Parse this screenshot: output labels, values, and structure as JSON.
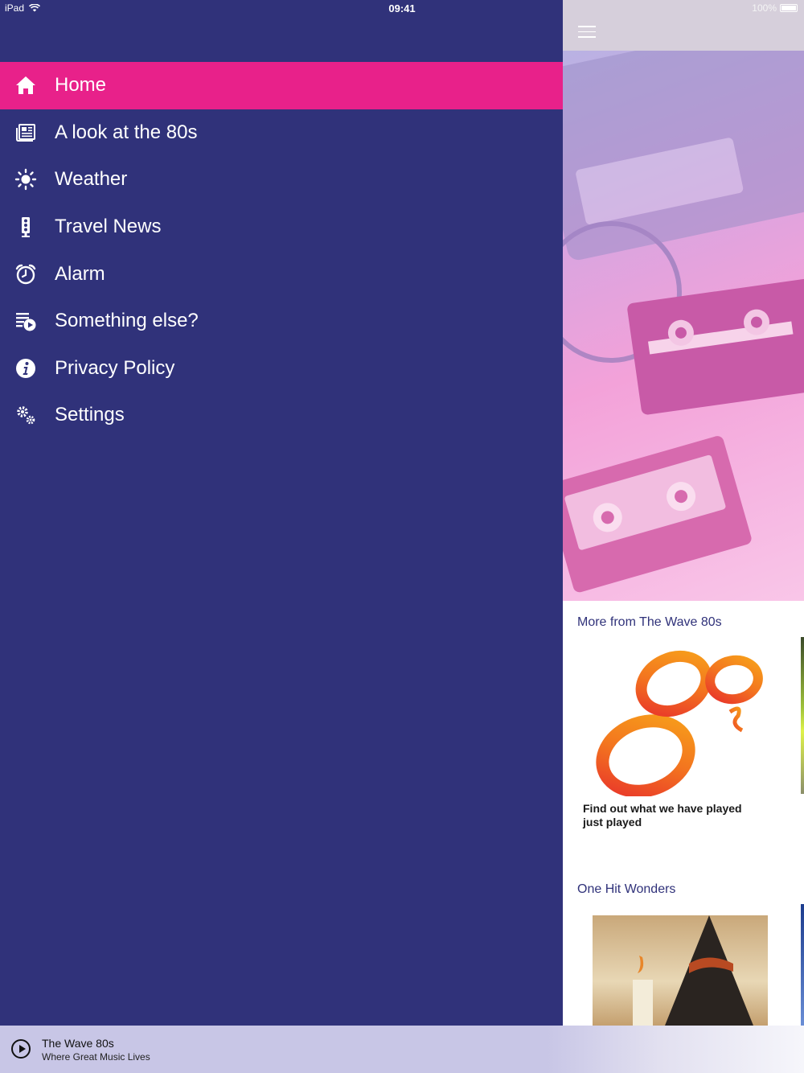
{
  "status_bar": {
    "device": "iPad",
    "time": "09:41",
    "battery": "100%"
  },
  "menu": {
    "items": [
      {
        "label": "Home",
        "icon": "home-icon",
        "active": true
      },
      {
        "label": "A look at the 80s",
        "icon": "news-icon"
      },
      {
        "label": "Weather",
        "icon": "sun-icon"
      },
      {
        "label": "Travel News",
        "icon": "traffic-light-icon"
      },
      {
        "label": "Alarm",
        "icon": "alarm-clock-icon"
      },
      {
        "label": "Something else?",
        "icon": "playlist-icon"
      },
      {
        "label": "Privacy Policy",
        "icon": "info-icon"
      },
      {
        "label": "Settings",
        "icon": "gears-icon"
      }
    ]
  },
  "content": {
    "sections": [
      {
        "title": "More from The Wave 80s",
        "card_caption": "Find out what we have played just played"
      },
      {
        "title": "One Hit Wonders"
      }
    ]
  },
  "player": {
    "title": "The Wave 80s",
    "subtitle": "Where Great Music Lives"
  },
  "colors": {
    "drawer_bg": "#30327a",
    "active_item": "#e8218a",
    "player_bg": "#c8c6e6"
  }
}
